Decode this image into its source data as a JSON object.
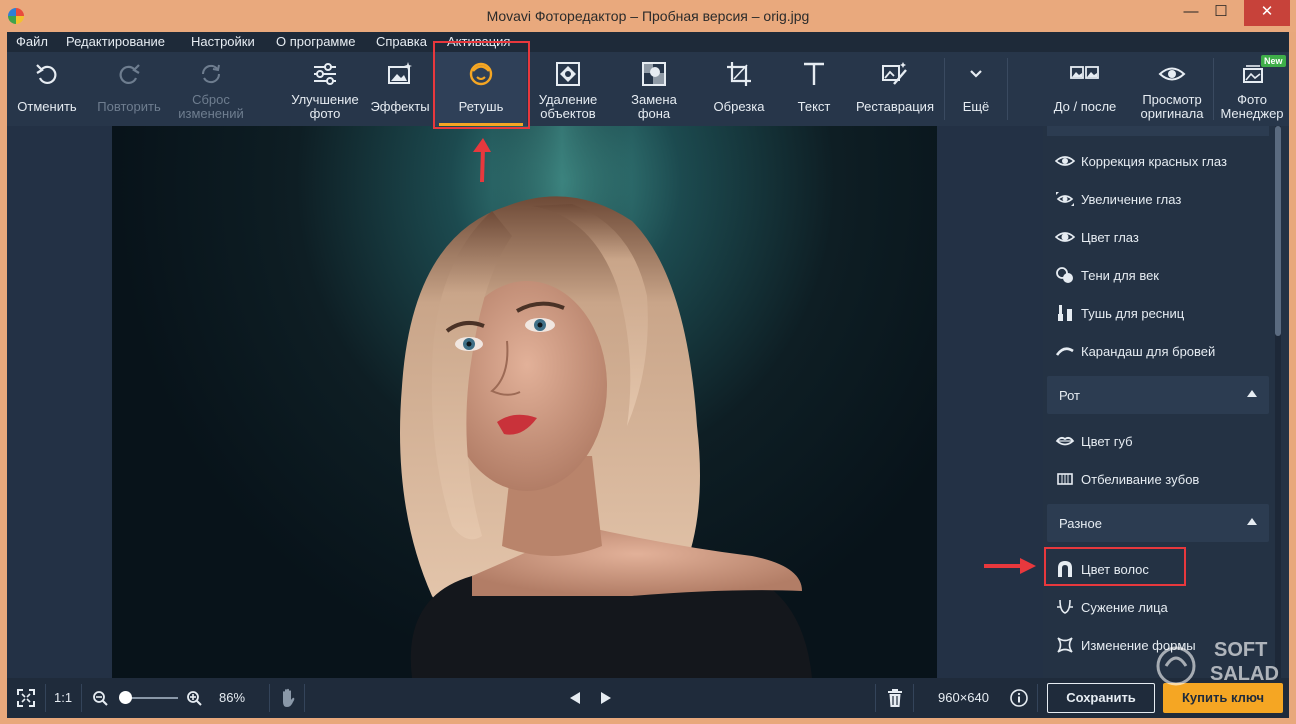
{
  "window": {
    "title": "Movavi Фоторедактор – Пробная версия – orig.jpg"
  },
  "menubar": {
    "items": [
      "Файл",
      "Редактирование",
      "Настройки",
      "О программе",
      "Справка",
      "Активация"
    ]
  },
  "toolbar": {
    "undo": "Отменить",
    "redo": "Повторить",
    "reset": "Сброс\nизменений",
    "enhance": "Улучшение\nфото",
    "effects": "Эффекты",
    "retouch": "Ретушь",
    "remove_objects": "Удаление\nобъектов",
    "replace_bg": "Замена\nфона",
    "crop": "Обрезка",
    "text": "Текст",
    "restoration": "Реставрация",
    "more": "Ещё",
    "before_after": "До / после",
    "view_original": "Просмотр\nоригинала",
    "photo_manager": "Фото\nМенеджер",
    "new_badge": "New"
  },
  "panel": {
    "eyes_items": [
      "Коррекция красных глаз",
      "Увеличение глаз",
      "Цвет глаз",
      "Тени для век",
      "Тушь для ресниц",
      "Карандаш для бровей"
    ],
    "mouth_section": "Рот",
    "mouth_items": [
      "Цвет губ",
      "Отбеливание зубов"
    ],
    "misc_section": "Разное",
    "misc_items": [
      "Цвет волос",
      "Сужение лица",
      "Изменение формы"
    ]
  },
  "bottombar": {
    "one_to_one": "1:1",
    "zoom_percent": "86%",
    "zoom_level": 0.1,
    "dimensions": "960×640",
    "save": "Сохранить",
    "buy": "Купить ключ"
  },
  "watermark": {
    "line1": "SOFT",
    "line2": "SALAD"
  },
  "colors": {
    "accent": "#f5a623",
    "highlight": "#e8383d",
    "panel_bg": "#243244"
  }
}
